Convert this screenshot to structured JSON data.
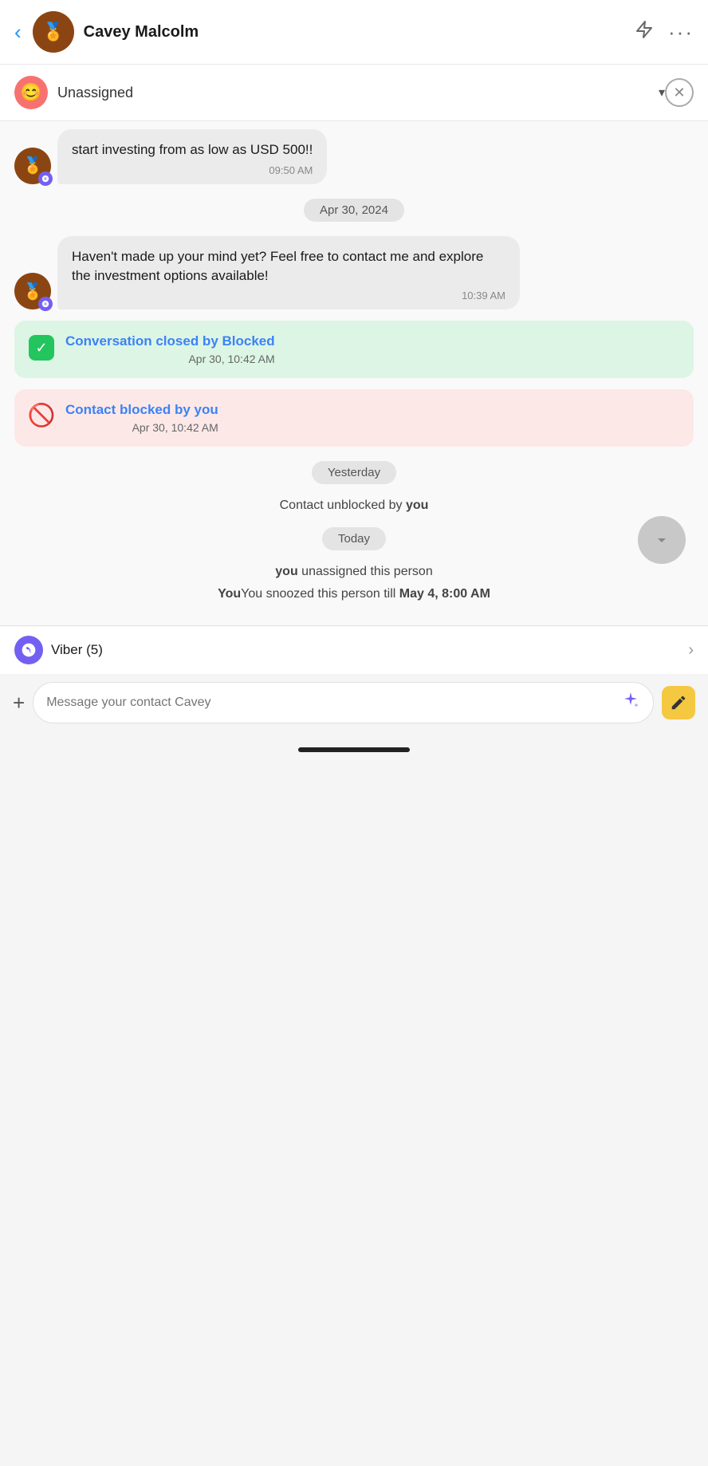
{
  "header": {
    "back_label": "‹",
    "title": "Cavey Malcolm",
    "avatar_emoji": "🏅",
    "lightning_icon": "⚡",
    "more_icon": "···"
  },
  "assign_bar": {
    "emoji": "😊",
    "label": "Unassigned",
    "chevron": "▾",
    "close_icon": "✕"
  },
  "messages": [
    {
      "text": "start investing from as low as USD 500!!",
      "time": "09:50 AM",
      "avatar_emoji": "🏅"
    },
    {
      "text": "Haven't made up your mind yet? Feel free to contact me and explore the investment options available!",
      "time": "10:39 AM",
      "avatar_emoji": "🏅"
    }
  ],
  "date_dividers": {
    "apr30": "Apr 30, 2024",
    "yesterday": "Yesterday",
    "today": "Today"
  },
  "events": {
    "closed": {
      "title": "Conversation closed by ",
      "actor": "Blocked",
      "time": "Apr 30, 10:42 AM"
    },
    "blocked": {
      "title": "Contact blocked by ",
      "actor": "you",
      "time": "Apr 30, 10:42 AM"
    },
    "unblocked": "Contact unblocked by ",
    "unblocked_actor": "you",
    "unassigned": " unassigned this person",
    "unassigned_actor": "you",
    "snoozed_prefix": "You snoozed this person till ",
    "snoozed_date": "May 4, 8:00 AM"
  },
  "viber_bar": {
    "icon": "V",
    "label": "Viber (5)",
    "chevron": "›"
  },
  "input_bar": {
    "plus_icon": "+",
    "placeholder": "Message your contact Cavey",
    "sparkle_icon": "✦",
    "note_icon": "✏"
  },
  "scroll_btn": {
    "icon": ""
  }
}
